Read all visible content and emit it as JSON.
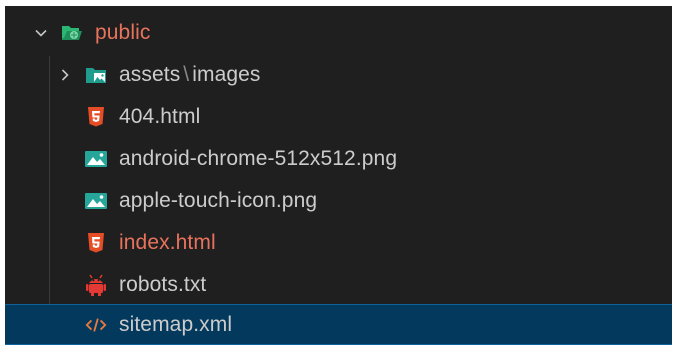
{
  "tree": {
    "root": {
      "label": "public",
      "expanded": true,
      "icon": "folder-public-open-icon",
      "color": "#e8735d"
    },
    "children": [
      {
        "type": "folder",
        "label_prefix": "assets",
        "separator": "\\",
        "label_suffix": "images",
        "expanded": false,
        "icon": "folder-images-icon"
      },
      {
        "type": "file",
        "label": "404.html",
        "icon": "html5-icon",
        "modified": false
      },
      {
        "type": "file",
        "label": "android-chrome-512x512.png",
        "icon": "image-file-icon",
        "modified": false
      },
      {
        "type": "file",
        "label": "apple-touch-icon.png",
        "icon": "image-file-icon",
        "modified": false
      },
      {
        "type": "file",
        "label": "index.html",
        "icon": "html5-icon",
        "modified": true
      },
      {
        "type": "file",
        "label": "robots.txt",
        "icon": "robot-icon",
        "modified": false
      },
      {
        "type": "file",
        "label": "sitemap.xml",
        "icon": "xml-code-icon",
        "modified": false,
        "selected": true
      }
    ]
  },
  "colors": {
    "background": "#1f1f1f",
    "text": "#cccccc",
    "modified": "#e8735d",
    "selection": "#04395e",
    "html5": "#e44d26",
    "image": "#26a69a",
    "robot": "#e53935",
    "xml": "#e87a3e"
  }
}
